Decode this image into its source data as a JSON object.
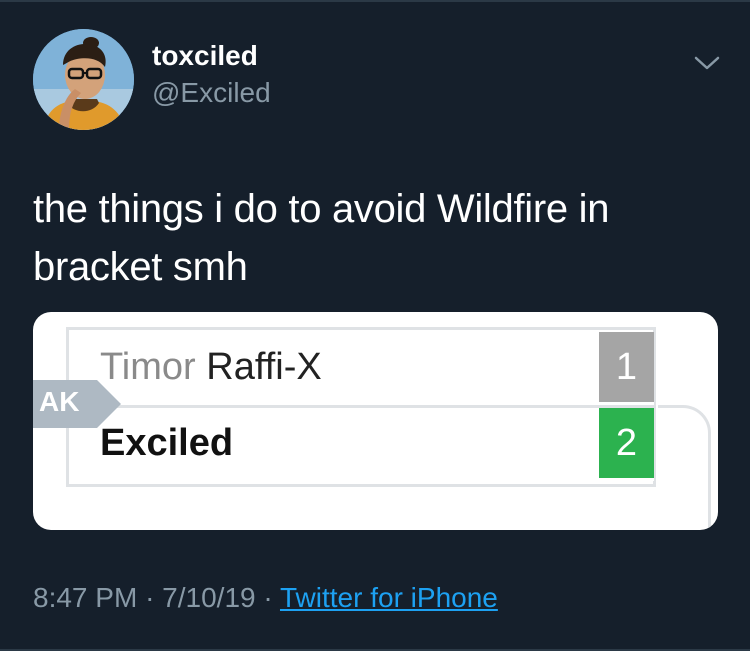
{
  "user": {
    "display_name": "toxciled",
    "handle": "@Exciled",
    "avatar_icon": "user-avatar-photo"
  },
  "menu": {
    "icon": "chevron-down-icon"
  },
  "tweet": {
    "text": "the things i do to avoid Wildfire in bracket smh"
  },
  "bracket": {
    "round_label": "AK",
    "players": [
      {
        "prefix": "Timor",
        "name": "Raffi-X",
        "score": "1",
        "status": "loss",
        "status_color": "#a5a5a5"
      },
      {
        "prefix": "",
        "name": "Exciled",
        "score": "2",
        "status": "win",
        "status_color": "#2cb24f"
      }
    ]
  },
  "meta": {
    "time": "8:47 PM",
    "date": "7/10/19",
    "separator": "·",
    "source": "Twitter for iPhone"
  },
  "colors": {
    "background": "#151f2b",
    "muted_text": "#8899a6",
    "link": "#1da1f2"
  }
}
